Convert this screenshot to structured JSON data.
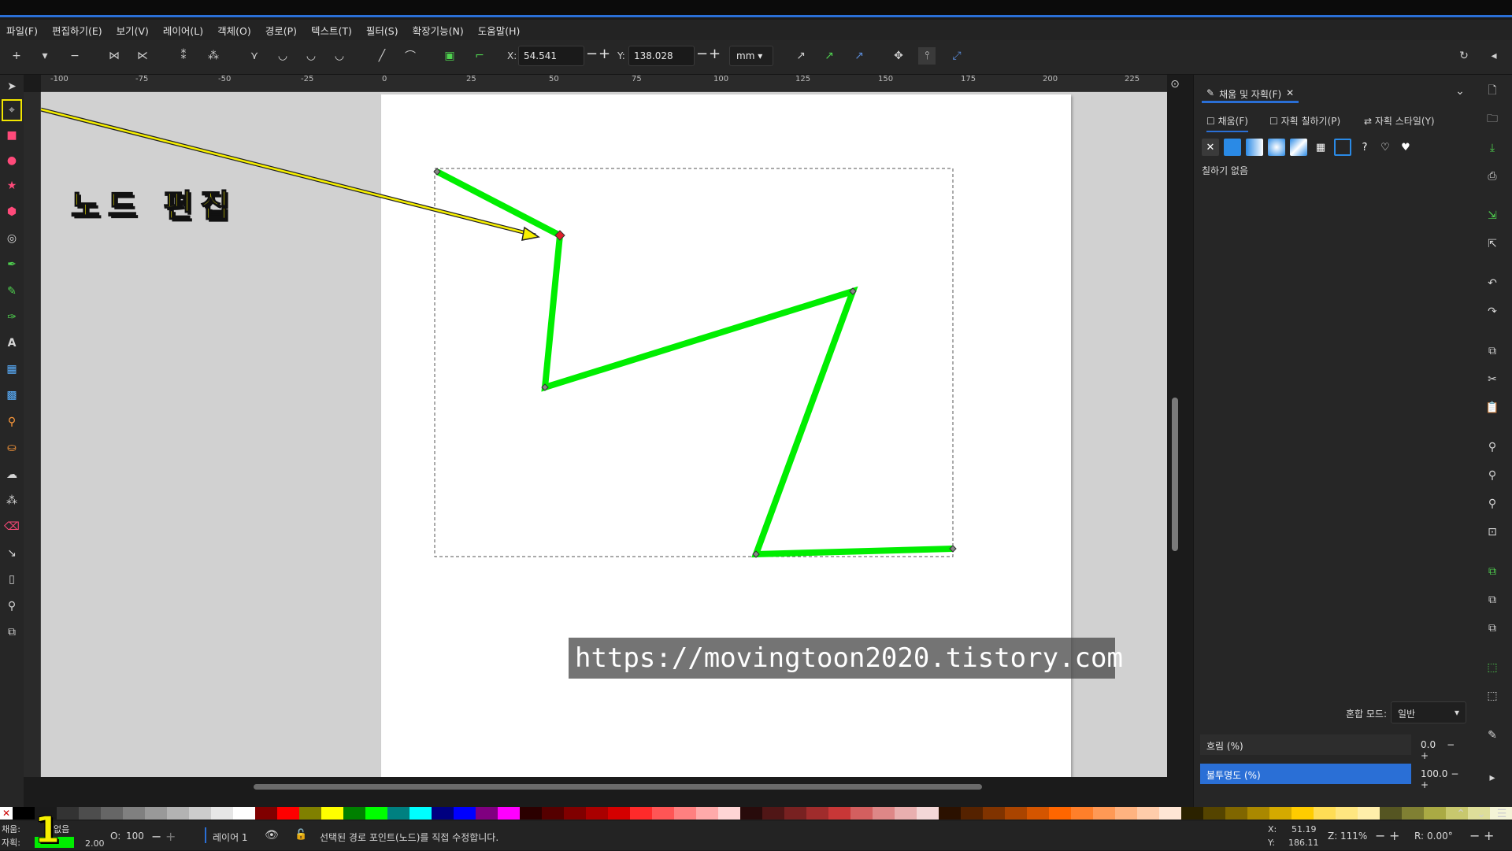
{
  "menu": [
    "파일(F)",
    "편집하기(E)",
    "보기(V)",
    "레이어(L)",
    "객체(O)",
    "경로(P)",
    "텍스트(T)",
    "필터(S)",
    "확장기능(N)",
    "도움말(H)"
  ],
  "toolbar": {
    "x_label": "X:",
    "x_value": "54.541",
    "y_label": "Y:",
    "y_value": "138.028",
    "unit": "mm"
  },
  "ruler_top_labels": [
    "-100",
    "-75",
    "-50",
    "-25",
    "0",
    "25",
    "50",
    "75",
    "100",
    "125",
    "150",
    "175",
    "200",
    "225"
  ],
  "canvas": {
    "annotation_label": "노드 편집",
    "watermark": "https://movingtoon2020.tistory.com",
    "path_color": "#00ee00",
    "selected_node_color": "#e0202a"
  },
  "panel": {
    "tab_title": "채움 및 자획(F)",
    "subtabs": [
      "채움(F)",
      "자획 칠하기(P)",
      "자획 스타일(Y)"
    ],
    "paint_status": "칠하기 없음",
    "blend_label": "혼합 모드:",
    "blend_value": "일반",
    "blur_label": "흐림 (%)",
    "blur_value": "0.0",
    "opacity_label": "불투명도 (%)",
    "opacity_value": "100.0"
  },
  "status": {
    "fill_label": "채움:",
    "stroke_label": "자획:",
    "fill_value": "없음",
    "stroke_width": "2.00",
    "opacity_label": "O:",
    "opacity_value": "100",
    "layer": "레이어 1",
    "message": "선택된 경로 포인트(노드)를 직접 수정합니다.",
    "cursor_x_label": "X:",
    "cursor_x": "51.19",
    "cursor_y_label": "Y:",
    "cursor_y": "186.11",
    "zoom_label": "Z:",
    "zoom": "111%",
    "rotate_label": "R:",
    "rotate": "0.00°",
    "overlay_number": "1"
  }
}
